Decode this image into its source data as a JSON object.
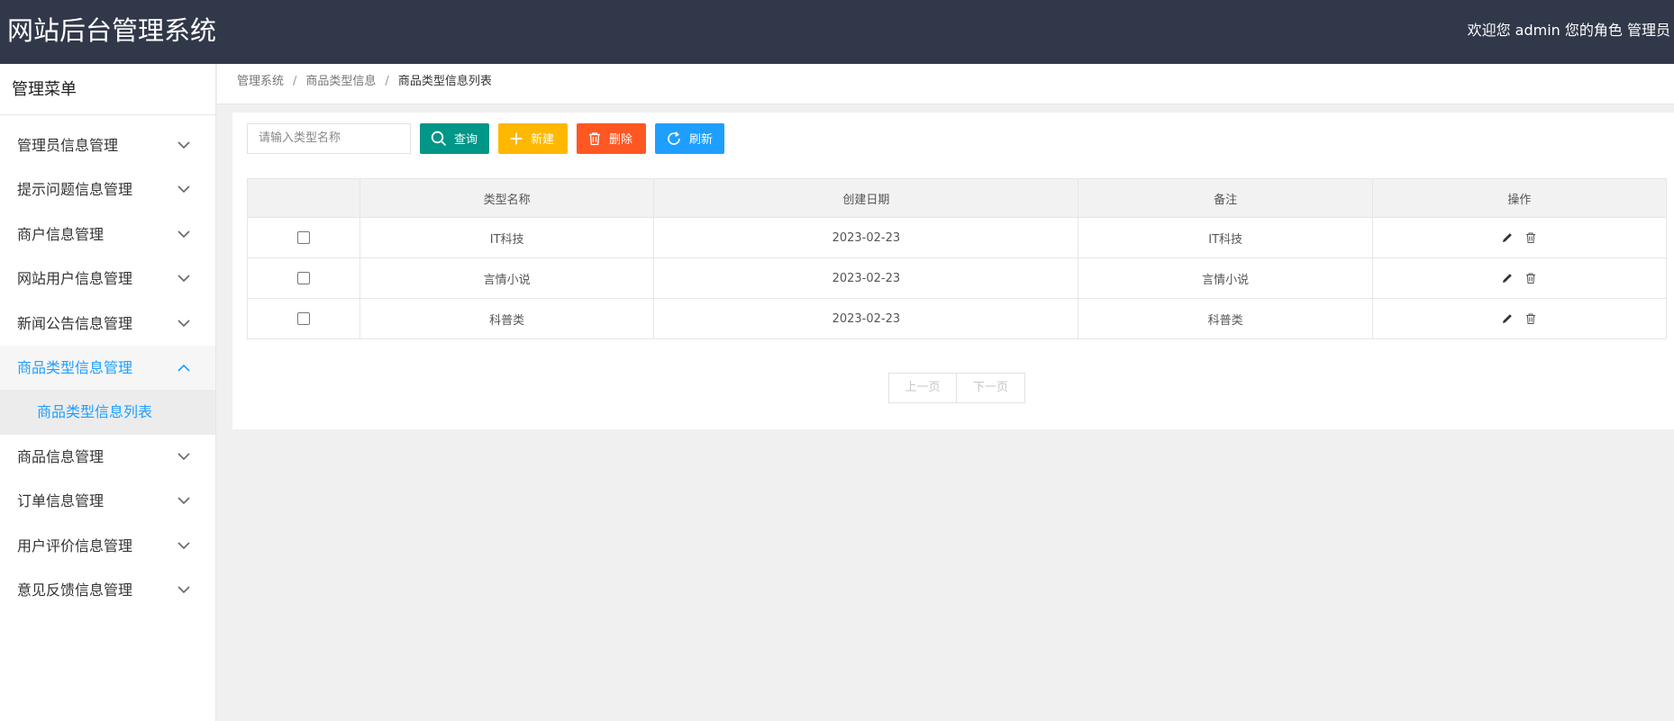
{
  "header": {
    "title": "网站后台管理系统",
    "user_info": "欢迎您 admin 您的角色 管理员"
  },
  "sidebar": {
    "title": "管理菜单",
    "groups": [
      {
        "label": "管理员信息管理",
        "expanded": false
      },
      {
        "label": "提示问题信息管理",
        "expanded": false
      },
      {
        "label": "商户信息管理",
        "expanded": false
      },
      {
        "label": "网站用户信息管理",
        "expanded": false
      },
      {
        "label": "新闻公告信息管理",
        "expanded": false
      },
      {
        "label": "商品类型信息管理",
        "expanded": true,
        "sub": "商品类型信息列表"
      },
      {
        "label": "商品信息管理",
        "expanded": false
      },
      {
        "label": "订单信息管理",
        "expanded": false
      },
      {
        "label": "用户评价信息管理",
        "expanded": false
      },
      {
        "label": "意见反馈信息管理",
        "expanded": false
      }
    ]
  },
  "breadcrumb": [
    "管理系统",
    "商品类型信息",
    "商品类型信息列表"
  ],
  "toolbar": {
    "search_placeholder": "请输入类型名称",
    "query_label": "查询",
    "add_label": "新建",
    "delete_label": "删除",
    "refresh_label": "刷新"
  },
  "table": {
    "columns": [
      "类型名称",
      "创建日期",
      "备注",
      "操作"
    ],
    "rows": [
      {
        "name": "IT科技",
        "date": "2023-02-23",
        "remark": "IT科技"
      },
      {
        "name": "言情小说",
        "date": "2023-02-23",
        "remark": "言情小说"
      },
      {
        "name": "科普类",
        "date": "2023-02-23",
        "remark": "科普类"
      }
    ]
  },
  "pager": {
    "prev_label": "上一页",
    "next_label": "下一页"
  },
  "colors": {
    "header_bg": "#313849",
    "accent_blue": "#1e9fff",
    "query_green": "#009688",
    "add_orange": "#ffb800",
    "delete_red": "#ff5722"
  }
}
